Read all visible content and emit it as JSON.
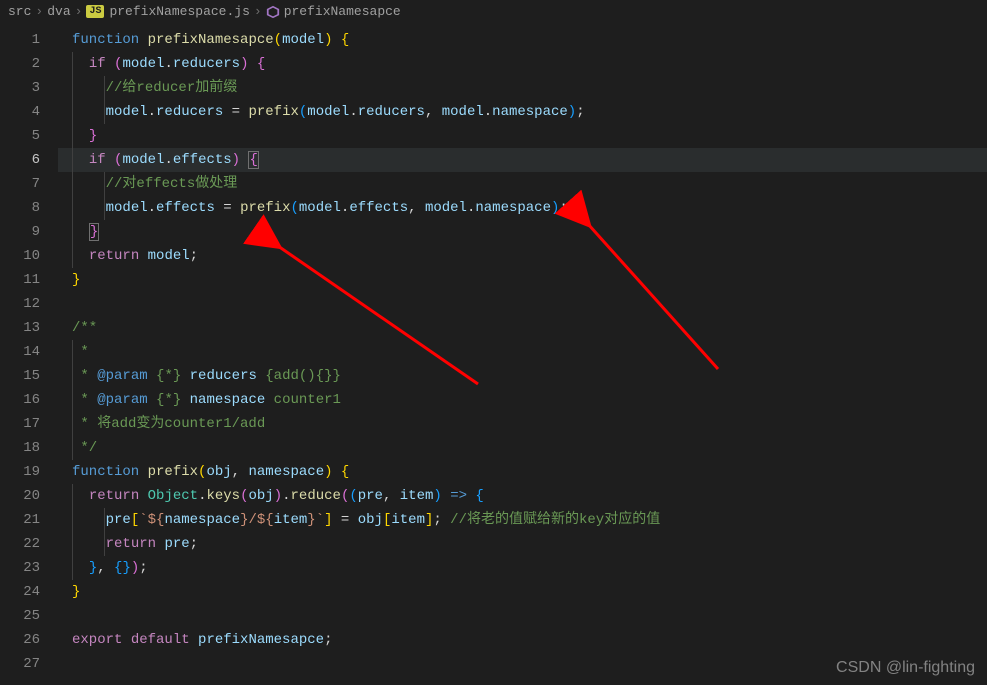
{
  "breadcrumbs": {
    "items": [
      "src",
      "dva",
      "prefixNamespace.js",
      "prefixNamesapce"
    ],
    "file_badge": "JS"
  },
  "gutter": {
    "start": 1,
    "end": 27,
    "active": 6
  },
  "code": {
    "l1": {
      "kw_func": "function",
      "fn": "prefixNamesapce",
      "p": "model"
    },
    "l2": {
      "kw_if": "if",
      "var": "model",
      "prop": "reducers"
    },
    "l3": {
      "comment": "//给reducer加前缀"
    },
    "l4": {
      "var": "model",
      "prop1": "reducers",
      "fn": "prefix",
      "arg1v": "model",
      "arg1p": "reducers",
      "arg2v": "model",
      "arg2p": "namespace"
    },
    "l6": {
      "kw_if": "if",
      "var": "model",
      "prop": "effects"
    },
    "l7": {
      "comment": "//对effects做处理"
    },
    "l8": {
      "var": "model",
      "prop1": "effects",
      "fn": "prefix",
      "arg1v": "model",
      "arg1p": "effects",
      "arg2v": "model",
      "arg2p": "namespace"
    },
    "l10": {
      "kw": "return",
      "var": "model"
    },
    "l13": {
      "t": "/**"
    },
    "l14": {
      "t": " * "
    },
    "l15": {
      "star": " * ",
      "tag": "@param",
      "type": " {*} ",
      "name": "reducers",
      "rest": " {add(){}}"
    },
    "l16": {
      "star": " * ",
      "tag": "@param",
      "type": " {*} ",
      "name": "namespace",
      "rest": " counter1"
    },
    "l17": {
      "t": " * 将add变为counter1/add"
    },
    "l18": {
      "t": " */"
    },
    "l19": {
      "kw_func": "function",
      "fn": "prefix",
      "p1": "obj",
      "p2": "namespace"
    },
    "l20": {
      "kw": "return",
      "type": "Object",
      "m1": "keys",
      "arg": "obj",
      "m2": "reduce",
      "p1": "pre",
      "p2": "item"
    },
    "l21": {
      "var": "pre",
      "s1": "`${",
      "sv1": "namespace",
      "s2": "}/${",
      "sv2": "item",
      "s3": "}`",
      "rhsv": "obj",
      "rhsi": "item",
      "comment": " //将老的值赋给新的key对应的值"
    },
    "l22": {
      "kw": "return",
      "var": "pre"
    },
    "l26": {
      "kw1": "export",
      "kw2": "default",
      "var": "prefixNamesapce"
    }
  },
  "watermark": "CSDN @lin-fighting"
}
